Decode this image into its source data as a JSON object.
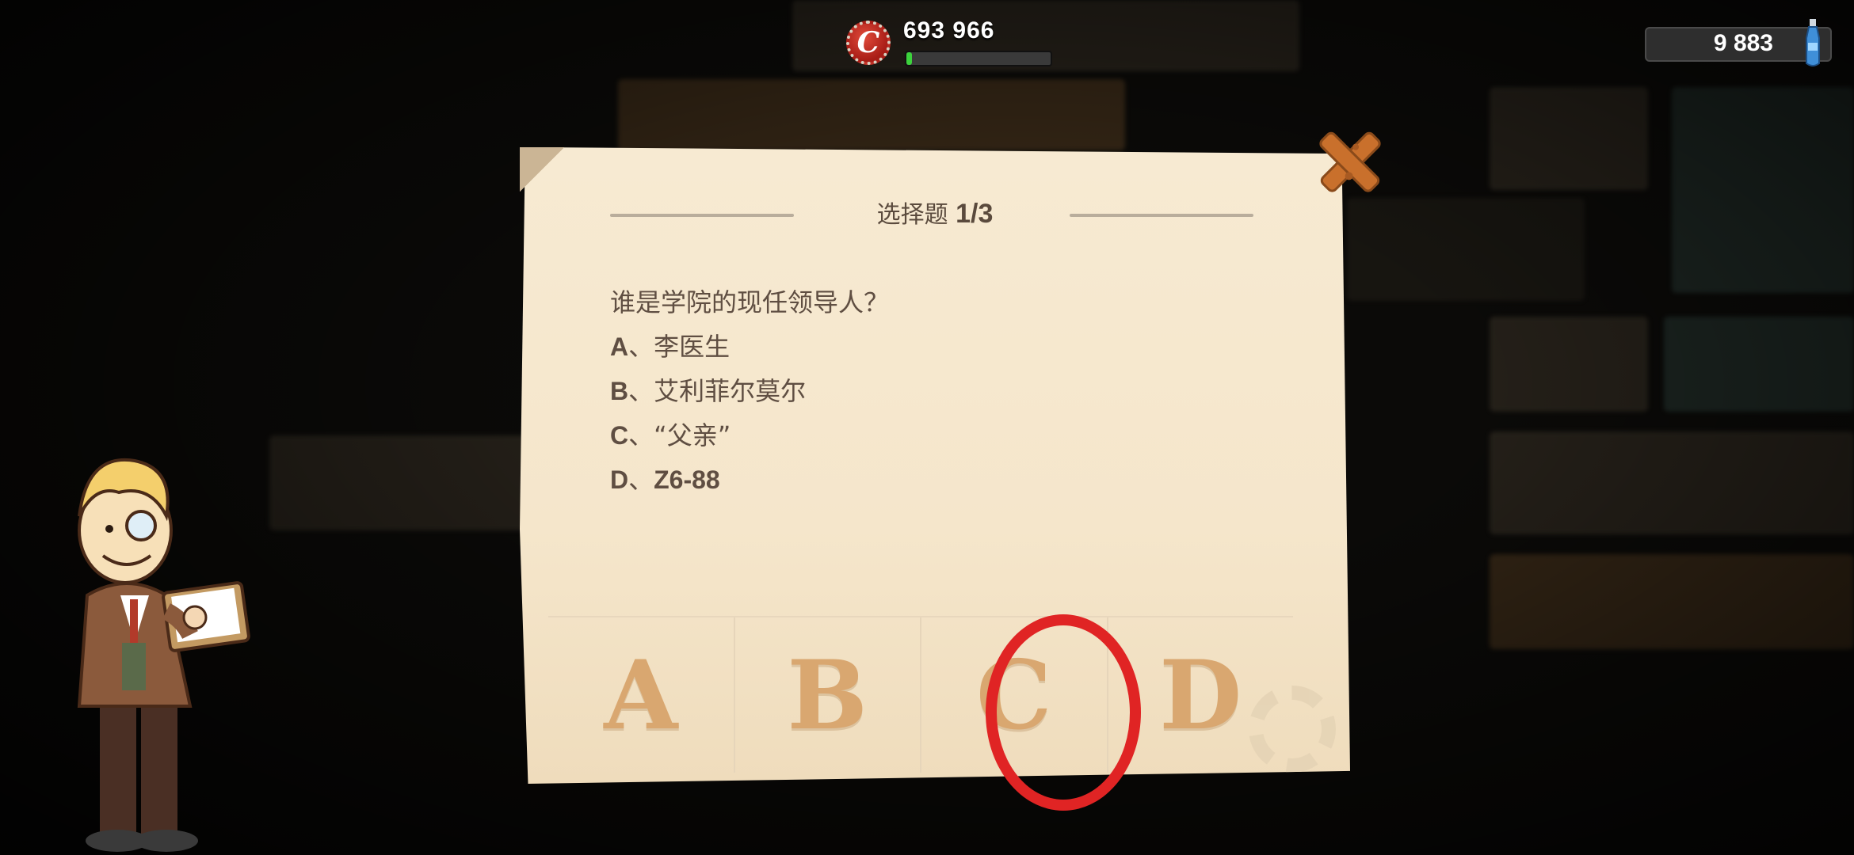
{
  "hud": {
    "caps_value": "693 966",
    "caps_icon": "bottle-cap-icon",
    "caps_icon_letter": "C",
    "xp_progress": 0.04,
    "quantum_value": "9 883",
    "quantum_icon": "nuka-quantum-bottle-icon"
  },
  "quiz": {
    "title_prefix": "选择题",
    "title_count": "1/3",
    "question": "谁是学院的现任领导人？",
    "options": [
      {
        "letter": "A",
        "sep": "、",
        "text": "李医生"
      },
      {
        "letter": "B",
        "sep": "、",
        "text": "艾利菲尔莫尔"
      },
      {
        "letter": "C",
        "sep": "、",
        "text": "“父亲”"
      },
      {
        "letter": "D",
        "sep": "、",
        "text": "Z6-88"
      }
    ],
    "answer_buttons": [
      "A",
      "B",
      "C",
      "D"
    ]
  },
  "colors": {
    "paper": "#f5e6cb",
    "answer_letter": "#d9a770",
    "text": "#5f4e42",
    "annotation_circle": "#e02424",
    "close_x": "#c9702c"
  }
}
